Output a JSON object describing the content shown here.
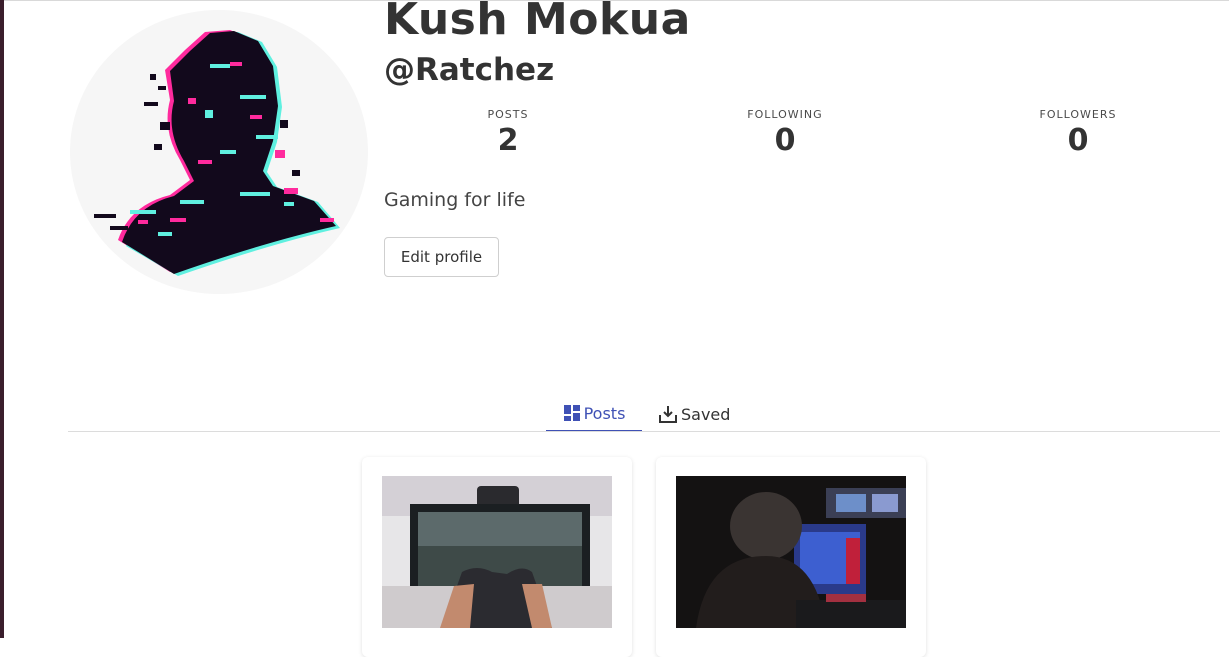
{
  "profile": {
    "name": "Kush Mokua",
    "handle": "@Ratchez",
    "bio": "Gaming for life",
    "edit_button": "Edit profile"
  },
  "stats": {
    "posts_label": "POSTS",
    "posts_value": "2",
    "following_label": "FOLLOWING",
    "following_value": "0",
    "followers_label": "FOLLOWERS",
    "followers_value": "0"
  },
  "tabs": [
    {
      "label": "Posts",
      "icon": "grid-icon",
      "active": true
    },
    {
      "label": "Saved",
      "icon": "download-icon",
      "active": false
    }
  ],
  "colors": {
    "accent": "#3f51b5",
    "text": "#333333"
  }
}
